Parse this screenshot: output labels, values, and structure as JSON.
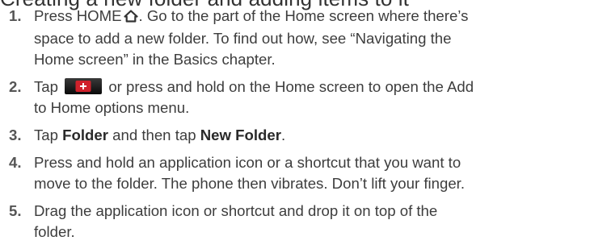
{
  "title": "Creating a new folder and adding items to it",
  "steps": [
    {
      "number": "1.",
      "line1_a": "Press HOME",
      "line1_b": ". Go to the part of the Home screen where there’s",
      "line2": "space to add a new folder. To find out how, see “Navigating the",
      "line3": "Home screen” in the Basics chapter."
    },
    {
      "number": "2.",
      "line1_a": "Tap",
      "line1_b": "or press and hold on the Home screen to open the Add",
      "line2": "to Home options menu."
    },
    {
      "number": "3.",
      "line1_a": "Tap ",
      "line1_ui1": "Folder",
      "line1_b": " and then tap ",
      "line1_ui2": "New Folder",
      "line1_c": "."
    },
    {
      "number": "4.",
      "line1": "Press and hold an application icon or a shortcut that you want to",
      "line2": "move to the folder. The phone then vibrates. Don’t lift your finger."
    },
    {
      "number": "5.",
      "line1": "Drag the application icon or shortcut and drop it on top of the",
      "line2": "folder."
    }
  ],
  "icons": {
    "home": "home-icon",
    "add": "add-plus-icon",
    "add_button_color": "#d0212b"
  }
}
